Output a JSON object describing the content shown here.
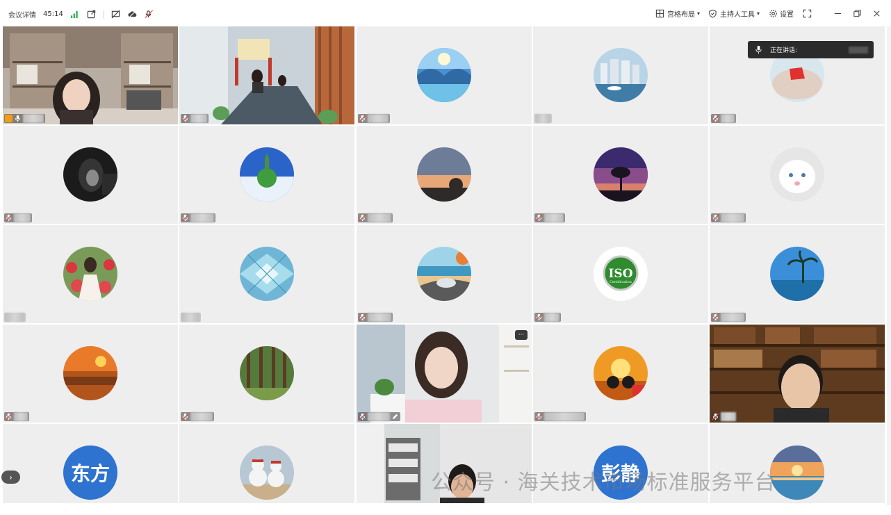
{
  "topbar": {
    "meeting_details": "会议详情",
    "timer": "45:14",
    "layout_label": "宫格布局",
    "host_tools_label": "主持人工具",
    "settings_label": "设置"
  },
  "speaking": {
    "label": "正在讲话:"
  },
  "tiles": {
    "dongfang_initials": "东方",
    "pengjing_initials": "彭静",
    "iso_text": "ISO",
    "iso_sub": "Certification"
  },
  "watermark": {
    "text": "公众号 · 海关技术市场标准服务平台"
  },
  "colors": {
    "avatar_blue": "#2f73d0",
    "tile_bg": "#eeeeee",
    "mic_muted": "#d9534f"
  }
}
